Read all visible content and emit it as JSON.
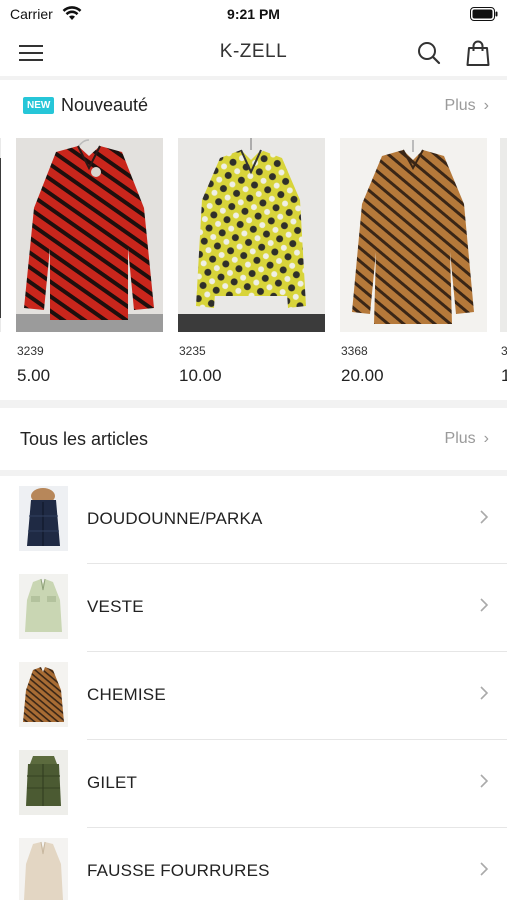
{
  "status_bar": {
    "carrier": "Carrier",
    "time": "9:21 PM"
  },
  "nav": {
    "title": "K-ZELL"
  },
  "new_section": {
    "badge": "NEW",
    "title": "Nouveauté",
    "more": "Plus"
  },
  "products": [
    {
      "ref": "3239",
      "price": "5.00"
    },
    {
      "ref": "3235",
      "price": "10.00"
    },
    {
      "ref": "3368",
      "price": "20.00"
    },
    {
      "ref": "3",
      "price": "1"
    }
  ],
  "all_section": {
    "title": "Tous les articles",
    "more": "Plus"
  },
  "categories": [
    {
      "label": "DOUDOUNNE/PARKA"
    },
    {
      "label": "VESTE"
    },
    {
      "label": "CHEMISE"
    },
    {
      "label": "GILET"
    },
    {
      "label": "FAUSSE FOURRURES"
    }
  ],
  "colors": {
    "accent": "#26c6d8",
    "muted": "#9a9a9a",
    "band": "#f2f2f2"
  }
}
